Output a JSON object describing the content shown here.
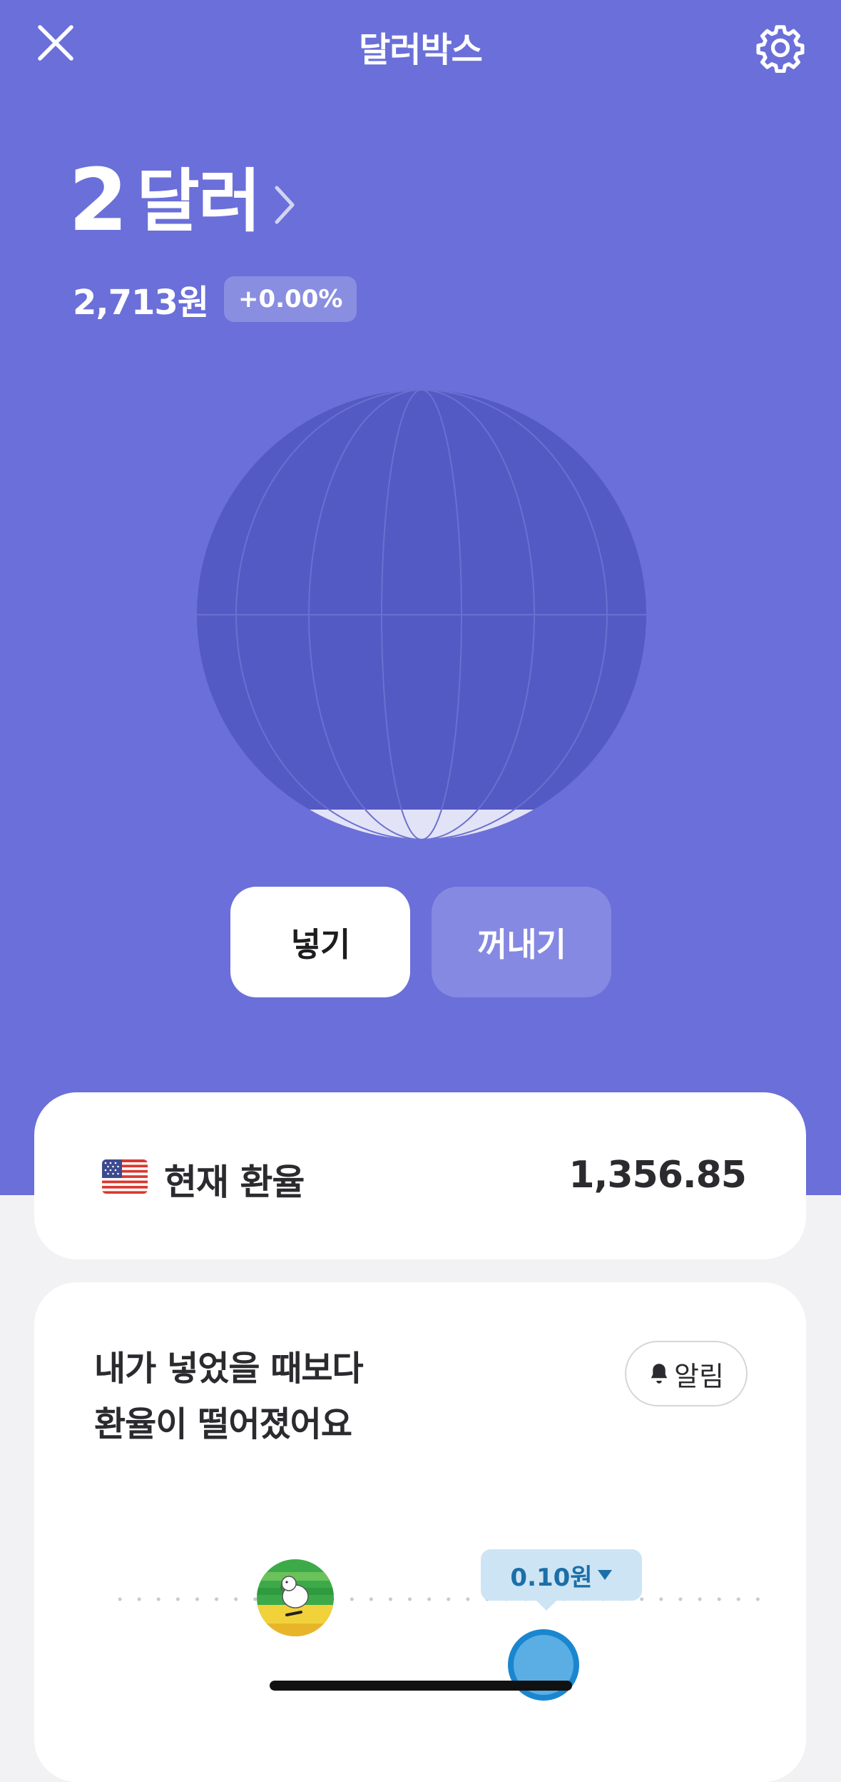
{
  "header": {
    "title": "달러박스",
    "close_icon": "close-icon",
    "settings_icon": "gear-icon"
  },
  "balance": {
    "amount": "2",
    "unit": "달러",
    "krw_value": "2,713원",
    "change_badge": "+0.00%"
  },
  "actions": {
    "deposit_label": "넣기",
    "withdraw_label": "꺼내기"
  },
  "exchange_rate": {
    "flag_icon": "us-flag-icon",
    "label": "현재 환율",
    "value": "1,356.85"
  },
  "trend": {
    "line1": "내가 넣었을 때보다",
    "line2": "환율이 떨어졌어요",
    "alarm_label": "알림",
    "diff_label": "0.10원"
  },
  "colors": {
    "hero_background": "#6a6fd9",
    "globe_fill": "#545ac4",
    "deposit_button": "#ffffff",
    "withdraw_button": "#8589e2",
    "tooltip_background": "#cde4f4",
    "tooltip_text": "#1b6fa8",
    "current_marker": "#5aaee4"
  }
}
